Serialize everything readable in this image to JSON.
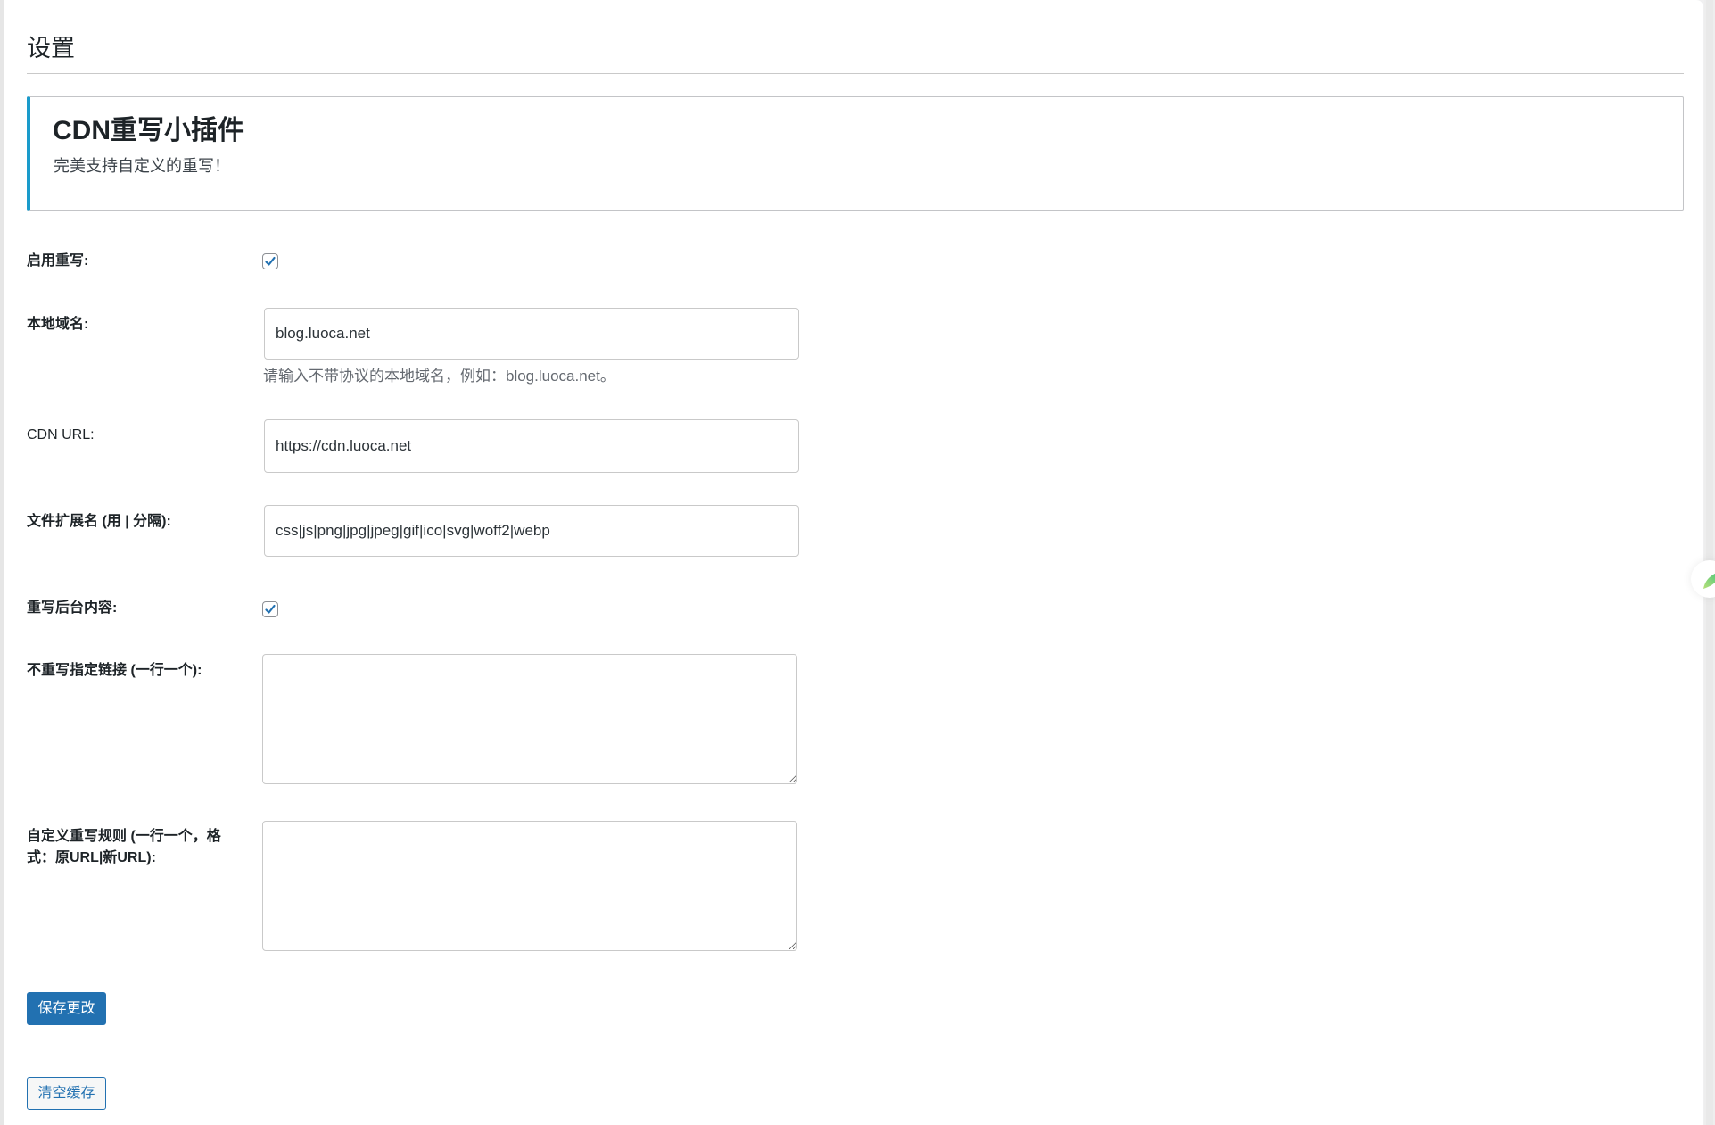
{
  "page": {
    "title": "设置"
  },
  "notice": {
    "title": "CDN重写小插件",
    "subtitle": "完美支持自定义的重写！",
    "accent_color": "#1a9bcb"
  },
  "form": {
    "enable_rewrite": {
      "label": "启用重写:",
      "checked": true
    },
    "local_domain": {
      "label": "本地域名:",
      "value": "blog.luoca.net",
      "help": "请输入不带协议的本地域名，例如：blog.luoca.net。"
    },
    "cdn_url": {
      "label": "CDN URL:",
      "value": "https://cdn.luoca.net"
    },
    "extensions": {
      "label": "文件扩展名 (用 | 分隔):",
      "value": "css|js|png|jpg|jpeg|gif|ico|svg|woff2|webp"
    },
    "rewrite_admin": {
      "label": "重写后台内容:",
      "checked": true
    },
    "exclude_links": {
      "label": "不重写指定链接 (一行一个):",
      "value": ""
    },
    "custom_rules": {
      "label": "自定义重写规则 (一行一个，格式：原URL|新URL):",
      "value": ""
    }
  },
  "buttons": {
    "save_label": "保存更改",
    "clear_cache_label": "清空缓存",
    "primary_color": "#2271b1"
  },
  "widget": {
    "icon": "leaf-icon"
  }
}
